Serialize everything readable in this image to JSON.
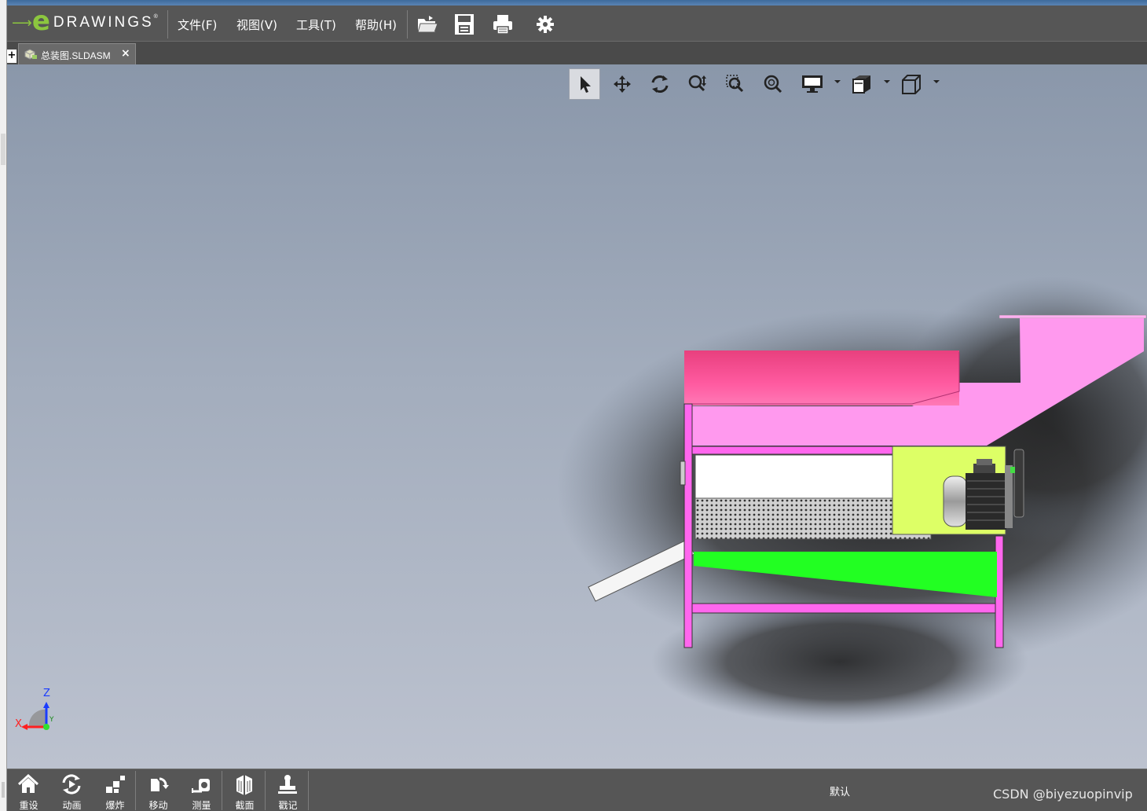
{
  "app": {
    "brand_e": "e",
    "brand_text": "DRAWINGS",
    "brand_reg": "®"
  },
  "menu": {
    "file": "文件(F)",
    "view": "视图(V)",
    "tools": "工具(T)",
    "help": "帮助(H)"
  },
  "toolbar_icons": [
    "open-icon",
    "save-icon",
    "print-icon",
    "gear-icon"
  ],
  "tabs": [
    {
      "label": "总装图.SLDASM",
      "close": "×"
    }
  ],
  "new_tab": "+",
  "view_tools": [
    "select-icon",
    "pan-icon",
    "rotate-icon",
    "zoom-icon",
    "zoom-to-area-icon",
    "zoom-to-fit-icon",
    "display-style-icon",
    "section-view-icon",
    "standard-views-icon"
  ],
  "triad": {
    "x": "X",
    "y": "Y",
    "z": "Z"
  },
  "bottom_tools": [
    {
      "label": "重设",
      "icon": "home-icon"
    },
    {
      "label": "动画",
      "icon": "animate-icon"
    },
    {
      "label": "爆炸",
      "icon": "explode-icon"
    },
    {
      "label": "移动",
      "icon": "move-icon"
    },
    {
      "label": "测量",
      "icon": "measure-icon"
    },
    {
      "label": "截面",
      "icon": "section-icon"
    },
    {
      "label": "戳记",
      "icon": "stamp-icon"
    }
  ],
  "configuration": "默认",
  "watermark": "CSDN @biyezuopinvip",
  "colors": {
    "chrome": "#565656",
    "brand_green": "#8cc63f",
    "hopper_magenta": "#ff5aa0",
    "frame_pink": "#ff99ee",
    "motor_plate": "#ddff66",
    "chute_green": "#22ff22"
  }
}
